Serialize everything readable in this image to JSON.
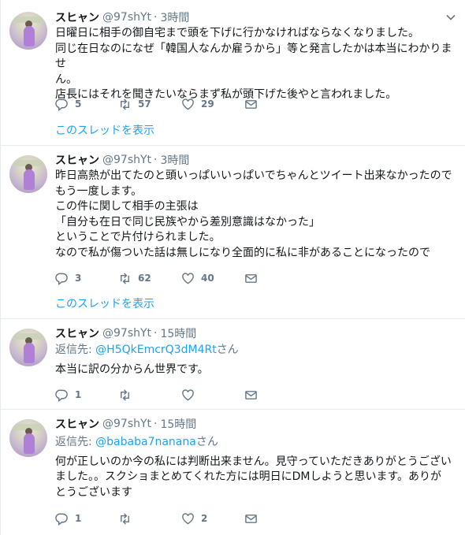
{
  "tweets": [
    {
      "name": "スヒャン",
      "handle": "@97shYt",
      "dot": "·",
      "time": "3時間",
      "lines": [
        "日曜日に相手の御自宅まで頭を下げに行かなければならなくなりました。",
        "同じ在日なのになぜ「韓国人なんか雇うから」等と発言したかは本当にわかりませ",
        "ん。",
        "店長にはそれを聞きたいならまず私が頭下げた後やと言われました。"
      ],
      "replies": "5",
      "retweets": "57",
      "likes": "29",
      "thread": "このスレッドを表示"
    },
    {
      "name": "スヒャン",
      "handle": "@97shYt",
      "dot": "·",
      "time": "3時間",
      "lines": [
        "昨日高熱が出てたのと頭いっぱいいっぱいでちゃんとツイート出来なかったので",
        "もう一度します。",
        "この件に関して相手の主張は",
        "「自分も在日で同じ民族やから差別意識はなかった」",
        "ということで片付けられました。",
        "なので私が傷ついた話は無しになり全面的に私に非があることになったので"
      ],
      "replies": "3",
      "retweets": "62",
      "likes": "40",
      "thread": "このスレッドを表示"
    },
    {
      "name": "スヒャン",
      "handle": "@97shYt",
      "dot": "·",
      "time": "15時間",
      "reply_prefix": "返信先: ",
      "reply_to": "@H5QkEmcrQ3dM4Rt",
      "reply_suffix": "さん",
      "lines": [
        "本当に訳の分からん世界です。"
      ],
      "replies": "1",
      "retweets": "",
      "likes": ""
    },
    {
      "name": "スヒャン",
      "handle": "@97shYt",
      "dot": "·",
      "time": "15時間",
      "reply_prefix": "返信先: ",
      "reply_to": "@bababa7nanana",
      "reply_suffix": "さん",
      "lines": [
        "何が正しいのか今の私には判断出来ません。見守っていただきありがとうござい",
        "ました。。スクショまとめてくれた方には明日にDMしようと思います。ありが",
        "とうございます"
      ],
      "replies": "1",
      "retweets": "",
      "likes": "2"
    }
  ],
  "icons": {
    "reply": "reply-icon",
    "retweet": "retweet-icon",
    "like": "heart-icon",
    "dm": "envelope-icon",
    "caret": "chevron-down-icon"
  },
  "colors": {
    "link": "#1da1f2",
    "muted": "#657786",
    "text": "#14171a",
    "border": "#e6ecf0"
  }
}
